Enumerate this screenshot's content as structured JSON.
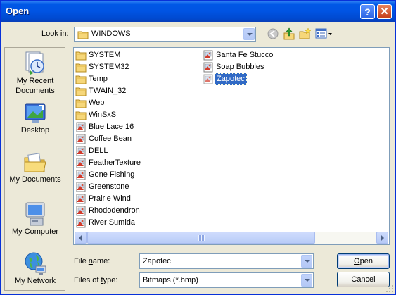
{
  "window": {
    "title": "Open",
    "help_glyph": "?",
    "close_glyph": "✕"
  },
  "lookin": {
    "label_prefix": "Look ",
    "label_accel": "i",
    "label_suffix": "n:",
    "value": "WINDOWS"
  },
  "places": [
    {
      "line1": "My Recent",
      "line2": "Documents",
      "icon": "recent-documents-icon"
    },
    {
      "line1": "Desktop",
      "line2": "",
      "icon": "desktop-icon"
    },
    {
      "line1": "My Documents",
      "line2": "",
      "icon": "my-documents-icon"
    },
    {
      "line1": "My Computer",
      "line2": "",
      "icon": "my-computer-icon"
    },
    {
      "line1": "My Network",
      "line2": "",
      "icon": "my-network-icon"
    }
  ],
  "files": {
    "col1": [
      {
        "name": "SYSTEM",
        "type": "folder"
      },
      {
        "name": "SYSTEM32",
        "type": "folder"
      },
      {
        "name": "Temp",
        "type": "folder"
      },
      {
        "name": "TWAIN_32",
        "type": "folder"
      },
      {
        "name": "Web",
        "type": "folder"
      },
      {
        "name": "WinSxS",
        "type": "folder"
      },
      {
        "name": "Blue Lace 16",
        "type": "bitmap"
      },
      {
        "name": "Coffee Bean",
        "type": "bitmap"
      },
      {
        "name": "DELL",
        "type": "bitmap"
      },
      {
        "name": "FeatherTexture",
        "type": "bitmap"
      },
      {
        "name": "Gone Fishing",
        "type": "bitmap"
      },
      {
        "name": "Greenstone",
        "type": "bitmap"
      },
      {
        "name": "Prairie Wind",
        "type": "bitmap"
      },
      {
        "name": "Rhododendron",
        "type": "bitmap"
      },
      {
        "name": "River Sumida",
        "type": "bitmap"
      }
    ],
    "col2": [
      {
        "name": "Santa Fe Stucco",
        "type": "bitmap"
      },
      {
        "name": "Soap Bubbles",
        "type": "bitmap"
      },
      {
        "name": "Zapotec",
        "type": "bitmap",
        "selected": true
      }
    ]
  },
  "filename": {
    "label_prefix": "File ",
    "label_accel": "n",
    "label_suffix": "ame:",
    "value": "Zapotec"
  },
  "filetype": {
    "label_prefix": "Files of ",
    "label_accel": "t",
    "label_suffix": "ype:",
    "value": "Bitmaps (*.bmp)"
  },
  "buttons": {
    "open_accel": "O",
    "open_rest": "pen",
    "cancel": "Cancel"
  },
  "colors": {
    "titlebar": "#0054E3",
    "selection": "#316AC5",
    "dialog_bg": "#ECE9D8"
  }
}
